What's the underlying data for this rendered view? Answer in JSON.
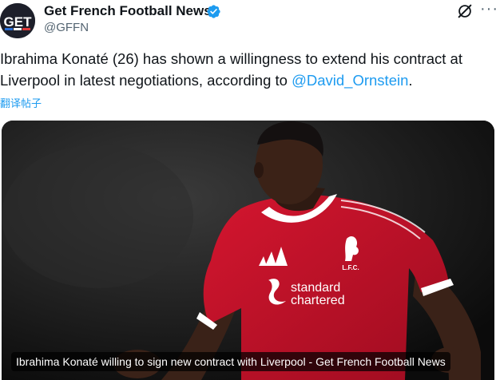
{
  "account": {
    "display_name": "Get French Football News",
    "handle": "@GFFN",
    "avatar_text": "GET"
  },
  "tweet": {
    "text_before": "Ibrahima Konaté (26) has shown a willingness to extend his contract at Liverpool in latest negotiations, according to ",
    "mention": "@David_Ornstein",
    "text_after": ".",
    "translate_label": "翻译帖子"
  },
  "media": {
    "caption": "Ibrahima Konaté willing to sign new contract with Liverpool - Get French Football News",
    "shirt_sponsor_line1": "standard",
    "shirt_sponsor_line2": "chartered",
    "crest_text": "L.F.C."
  },
  "colors": {
    "link": "#1d9bf0",
    "shirt_red": "#c8102e",
    "text_primary": "#0f1419",
    "text_secondary": "#536471"
  },
  "icons": [
    "verified-badge-icon",
    "grok-icon",
    "more-options-icon"
  ]
}
